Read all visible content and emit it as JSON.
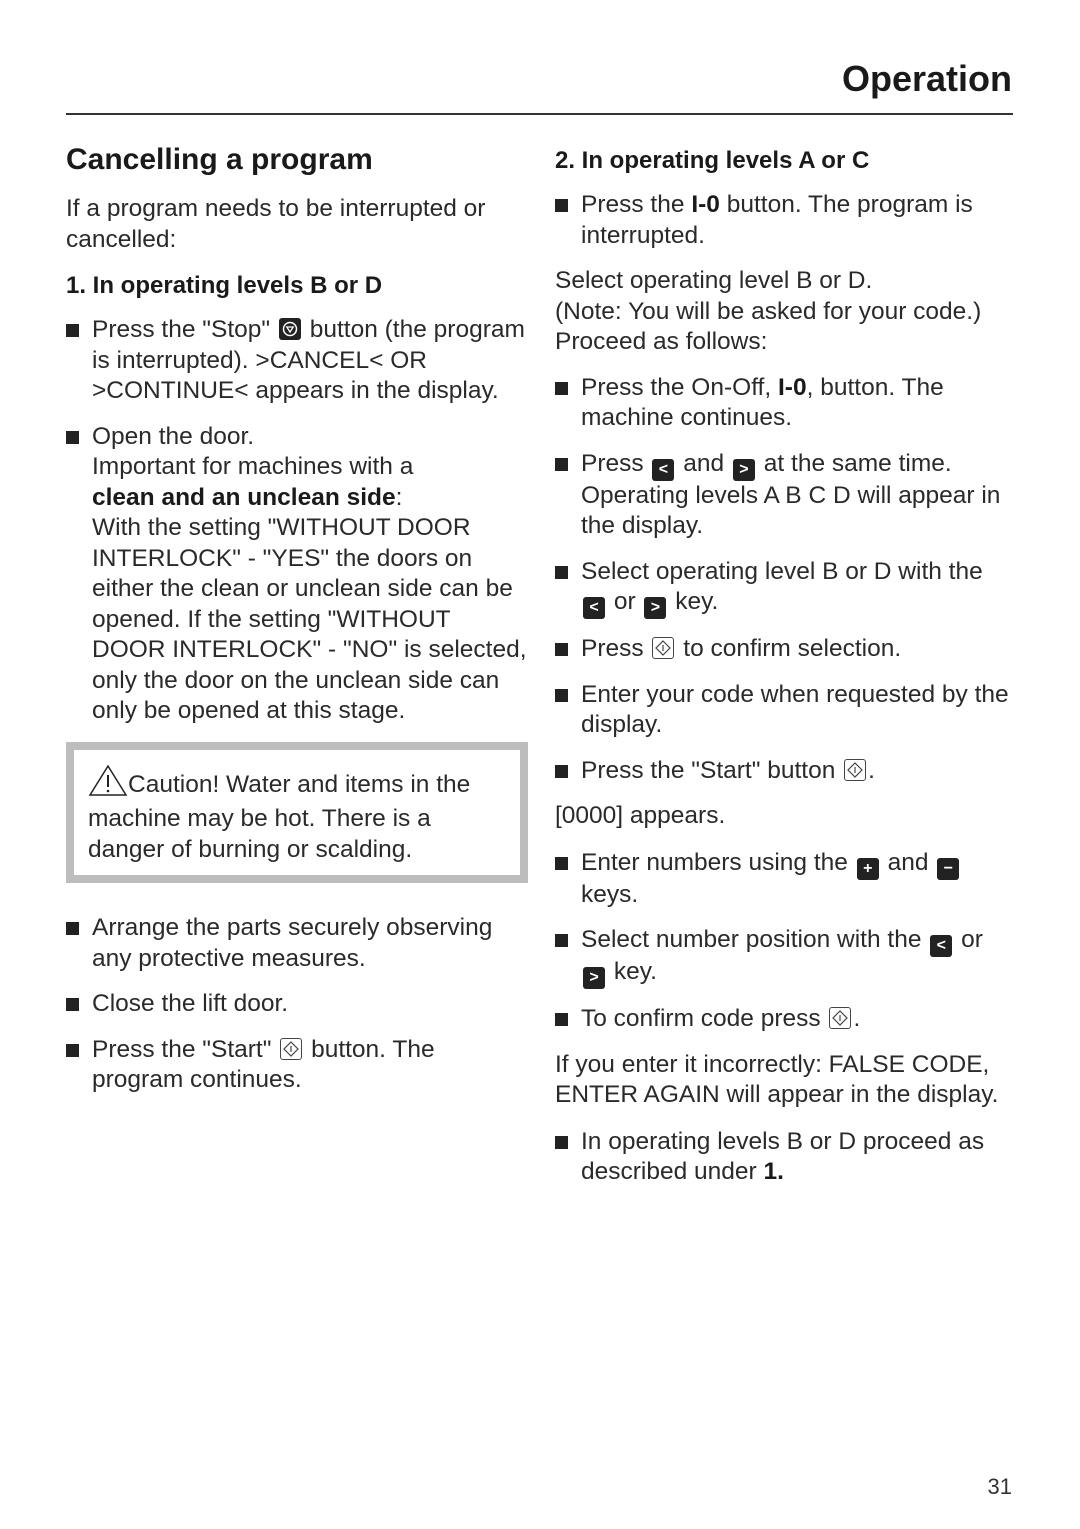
{
  "header": {
    "title": "Operation"
  },
  "left": {
    "heading": "Cancelling a program",
    "intro": "If a program needs to be interrupted or cancelled:",
    "subheading": "1. In operating levels B or D",
    "b1": {
      "pre": "Press the \"Stop\"",
      "post": "button (the program is interrupted). >CANCEL< OR >CONTINUE< appears in the display."
    },
    "b2": {
      "l1": "Open the door.",
      "l2": "Important for machines with a",
      "bold": "clean and an unclean side",
      "colon": ":",
      "rest": "With the setting \"WITHOUT DOOR INTERLOCK\" - \"YES\" the doors on either the clean or unclean side can be opened. If the setting \"WITHOUT DOOR INTERLOCK\" - \"NO\" is selected, only the door on the unclean side can only be opened at this stage."
    },
    "caution": "Caution! Water and items in the machine may be hot. There is a danger of burning or scalding.",
    "b3": "Arrange the parts securely observing any protective measures.",
    "b4": "Close the lift door.",
    "b5": {
      "pre": "Press the \"Start\"",
      "post": "button. The program continues."
    }
  },
  "right": {
    "subheading": "2. In operating levels A or C",
    "b1": {
      "pre": "Press the",
      "bold": "I-0",
      "post": "button. The program is interrupted."
    },
    "p1": "Select operating level B or D.",
    "p2": "(Note: You will be asked for your code.)",
    "p3": "Proceed as follows:",
    "b2": {
      "pre": "Press the On-Off,",
      "bold": "I-0",
      "post": ", button. The machine continues."
    },
    "b3": {
      "pre": "Press",
      "mid": "and",
      "post": "at the same time. Operating levels A B C D will appear in the display."
    },
    "b4": {
      "pre": "Select operating level B or D with the",
      "mid": "or",
      "post": "key."
    },
    "b5": {
      "pre": "Press",
      "post": "to confirm selection."
    },
    "b6": "Enter your code when requested by the display.",
    "b7": {
      "pre": "Press the \"Start\" button",
      "post": "."
    },
    "p4": "[0000] appears.",
    "b8": {
      "pre": "Enter numbers using the",
      "mid": "and",
      "post": "keys."
    },
    "b9": {
      "pre": "Select number position with the",
      "mid": "or",
      "post": "key."
    },
    "b10": {
      "pre": "To confirm code press",
      "post": "."
    },
    "p5": "If you enter it incorrectly:  FALSE CODE, ENTER AGAIN will appear in the display.",
    "b11": {
      "pre": "In operating levels B or D proceed as described under",
      "bold": "1."
    }
  },
  "keys": {
    "left": "<",
    "right": ">",
    "plus": "+",
    "minus": "−"
  },
  "page_number": "31"
}
